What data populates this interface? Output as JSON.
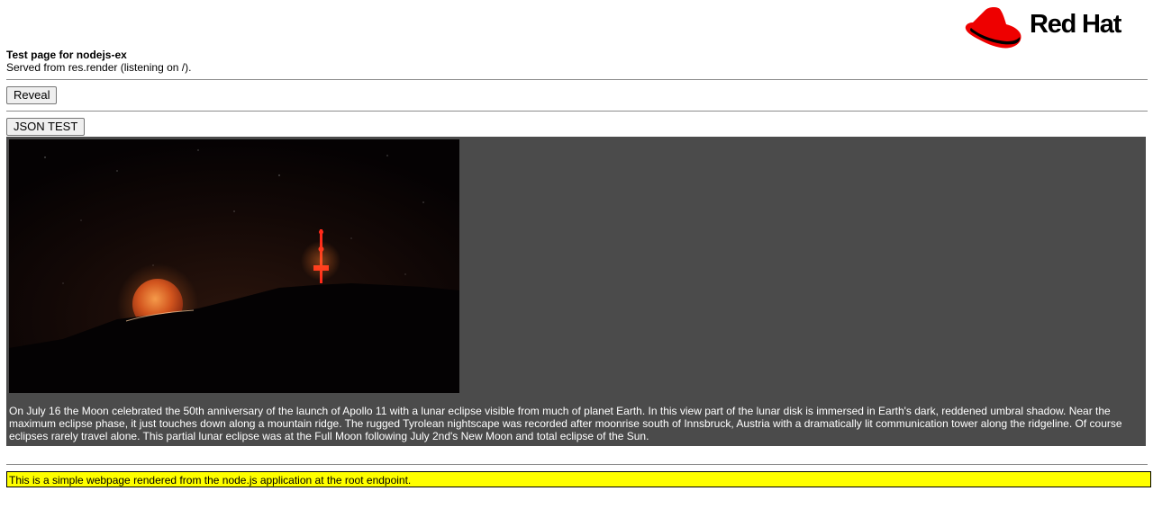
{
  "header": {
    "brand_name": "Red Hat",
    "title": "Test page for nodejs-ex",
    "subtitle": "Served from res.render (listening on /)."
  },
  "buttons": {
    "reveal_label": "Reveal",
    "json_test_label": "JSON TEST"
  },
  "apod": {
    "caption": "On July 16 the Moon celebrated the 50th anniversary of the launch of Apollo 11 with a lunar eclipse visible from much of planet Earth. In this view part of the lunar disk is immersed in Earth's dark, reddened umbral shadow. Near the maximum eclipse phase, it just touches down along a mountain ridge. The rugged Tyrolean nightscape was recorded after moonrise south of Innsbruck, Austria with a dramatically lit communication tower along the ridgeline. Of course eclipses rarely travel alone. This partial lunar eclipse was at the Full Moon following July 2nd's New Moon and total eclipse of the Sun."
  },
  "footer": {
    "text": "This is a simple webpage rendered from the node.js application at the root endpoint."
  },
  "colors": {
    "brand_red": "#ee0000",
    "panel_bg": "#4b4b4b",
    "footer_bg": "#ffff00"
  }
}
